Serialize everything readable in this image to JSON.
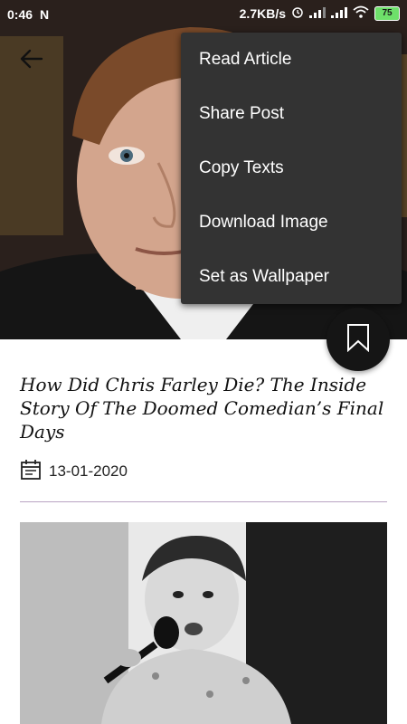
{
  "status_bar": {
    "time": "0:46",
    "notification": "N",
    "net_speed": "2.7KB/s",
    "battery": "75"
  },
  "menu": {
    "items": [
      {
        "label": "Read Article"
      },
      {
        "label": "Share Post"
      },
      {
        "label": "Copy Texts"
      },
      {
        "label": "Download Image"
      },
      {
        "label": "Set as Wallpaper"
      }
    ]
  },
  "article": {
    "title": "How Did Chris Farley Die? The Inside Story Of The Doomed Comedian’s Final Days",
    "date": "13-01-2020"
  },
  "icons": {
    "back": "back-arrow-icon",
    "bookmark": "bookmark-icon",
    "calendar": "calendar-icon"
  },
  "colors": {
    "menu_bg": "#333333",
    "fab_bg": "#151515",
    "divider": "#b9a3c2",
    "battery": "#6ee06a"
  }
}
